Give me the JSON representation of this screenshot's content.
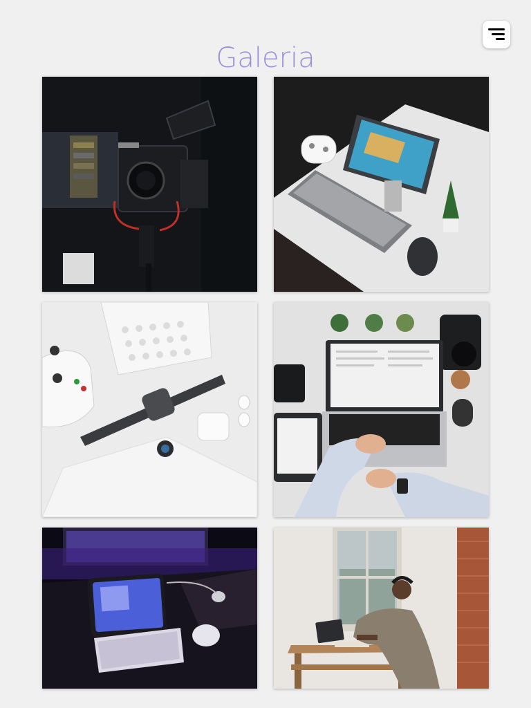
{
  "header": {
    "title": "Galeria"
  },
  "menu": {
    "icon": "menu-icon"
  },
  "gallery": {
    "items": [
      {
        "subject": "cinema-camera-rig"
      },
      {
        "subject": "desk-tablet-keyboard-controller"
      },
      {
        "subject": "white-controller-keyboard-watch-earbuds"
      },
      {
        "subject": "laptop-hands-desk-camera"
      },
      {
        "subject": "tablet-keyboard-purple-light"
      },
      {
        "subject": "man-working-laptop-window"
      }
    ]
  }
}
